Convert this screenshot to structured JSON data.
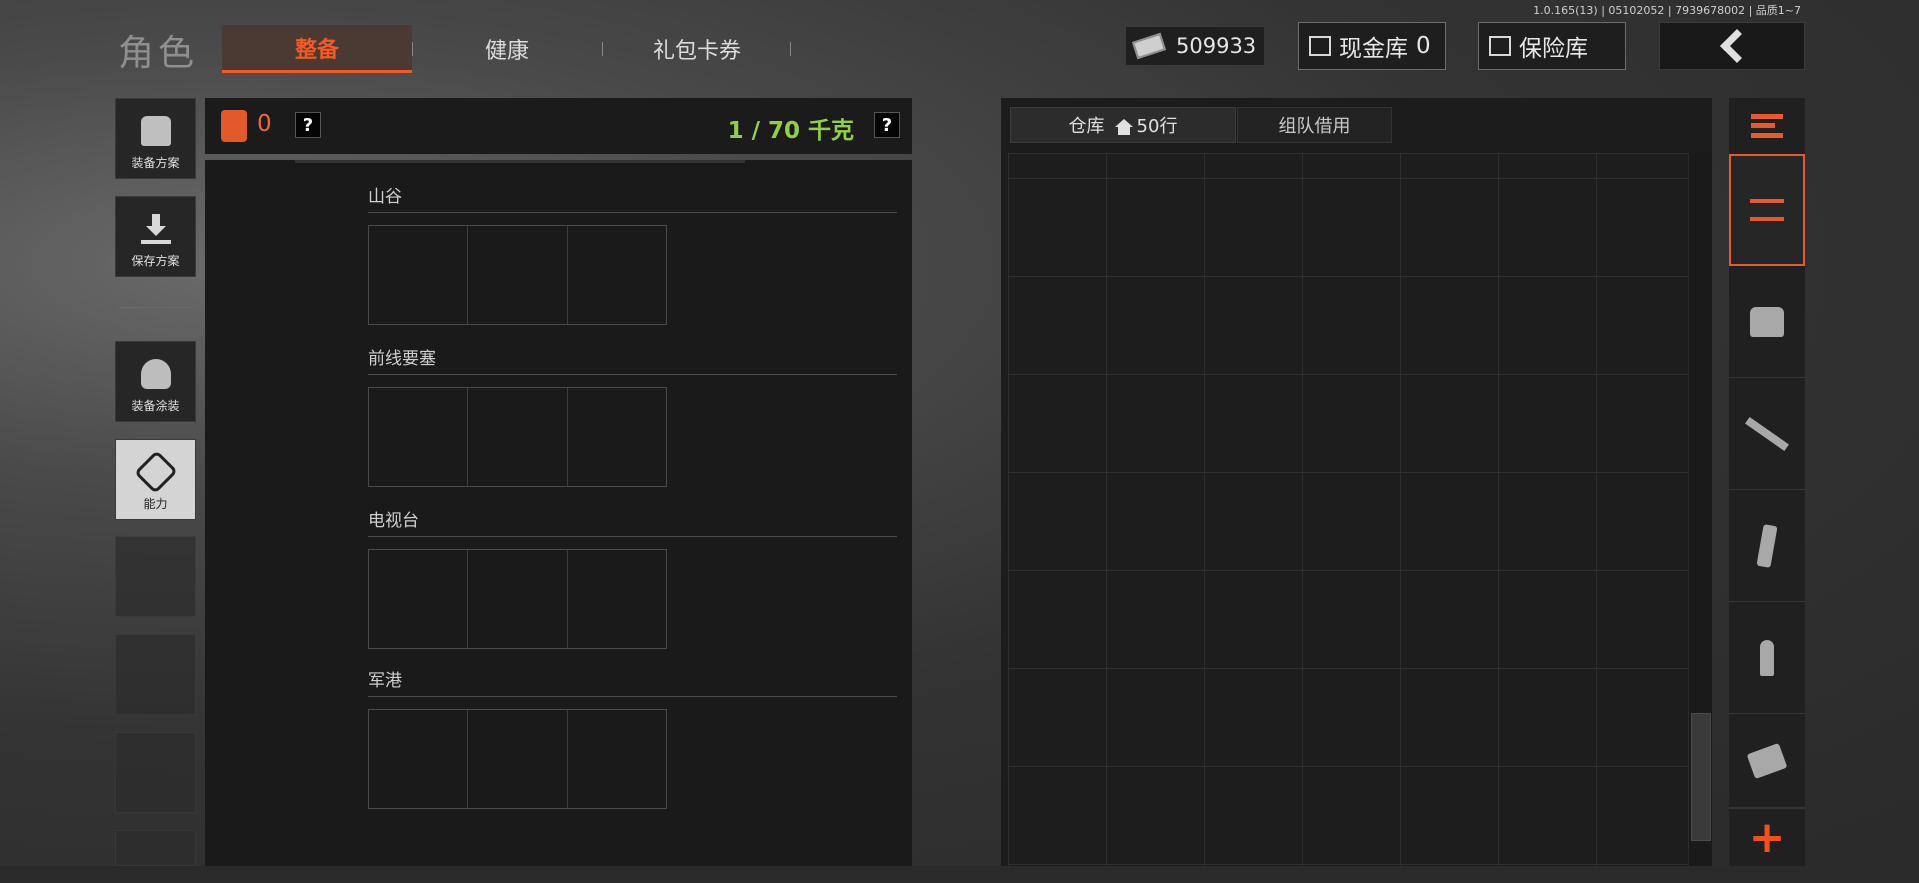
{
  "version_text": "1.0.165(13) | 05102052 | 7939678002 | 品质1~7",
  "header": {
    "title": "角色",
    "tabs": [
      {
        "label": "整备",
        "active": true
      },
      {
        "label": "健康",
        "active": false
      },
      {
        "label": "礼包卡券",
        "active": false
      }
    ],
    "currency": "509933",
    "cash_vault_label": "现金库",
    "cash_vault_value": "0",
    "safe_label": "保险库"
  },
  "sidebar": {
    "items": [
      {
        "label": "装备方案",
        "icon": "vest-icon"
      },
      {
        "label": "保存方案",
        "icon": "download-icon"
      },
      {
        "label": "装备涂装",
        "icon": "helmet-icon"
      },
      {
        "label": "能力",
        "icon": "ability-icon"
      }
    ]
  },
  "loadout": {
    "bag_count": "0",
    "weight_text": "1 / 70 千克",
    "help": "?",
    "sections": [
      {
        "title": "山谷"
      },
      {
        "title": "前线要塞"
      },
      {
        "title": "电视台"
      },
      {
        "title": "军港"
      }
    ]
  },
  "warehouse": {
    "tab_label": "仓库",
    "rows_label": "50行",
    "team_tab_label": "组队借用"
  },
  "filters": {
    "items": [
      "sort-layers-icon",
      "armor-icon",
      "rifle-icon",
      "magazine-icon",
      "ammo-icon",
      "scope-icon"
    ],
    "add": "+"
  },
  "colors": {
    "accent": "#f05a24",
    "weight_green": "#8fd046",
    "panel_bg": "#1b1b1b"
  }
}
